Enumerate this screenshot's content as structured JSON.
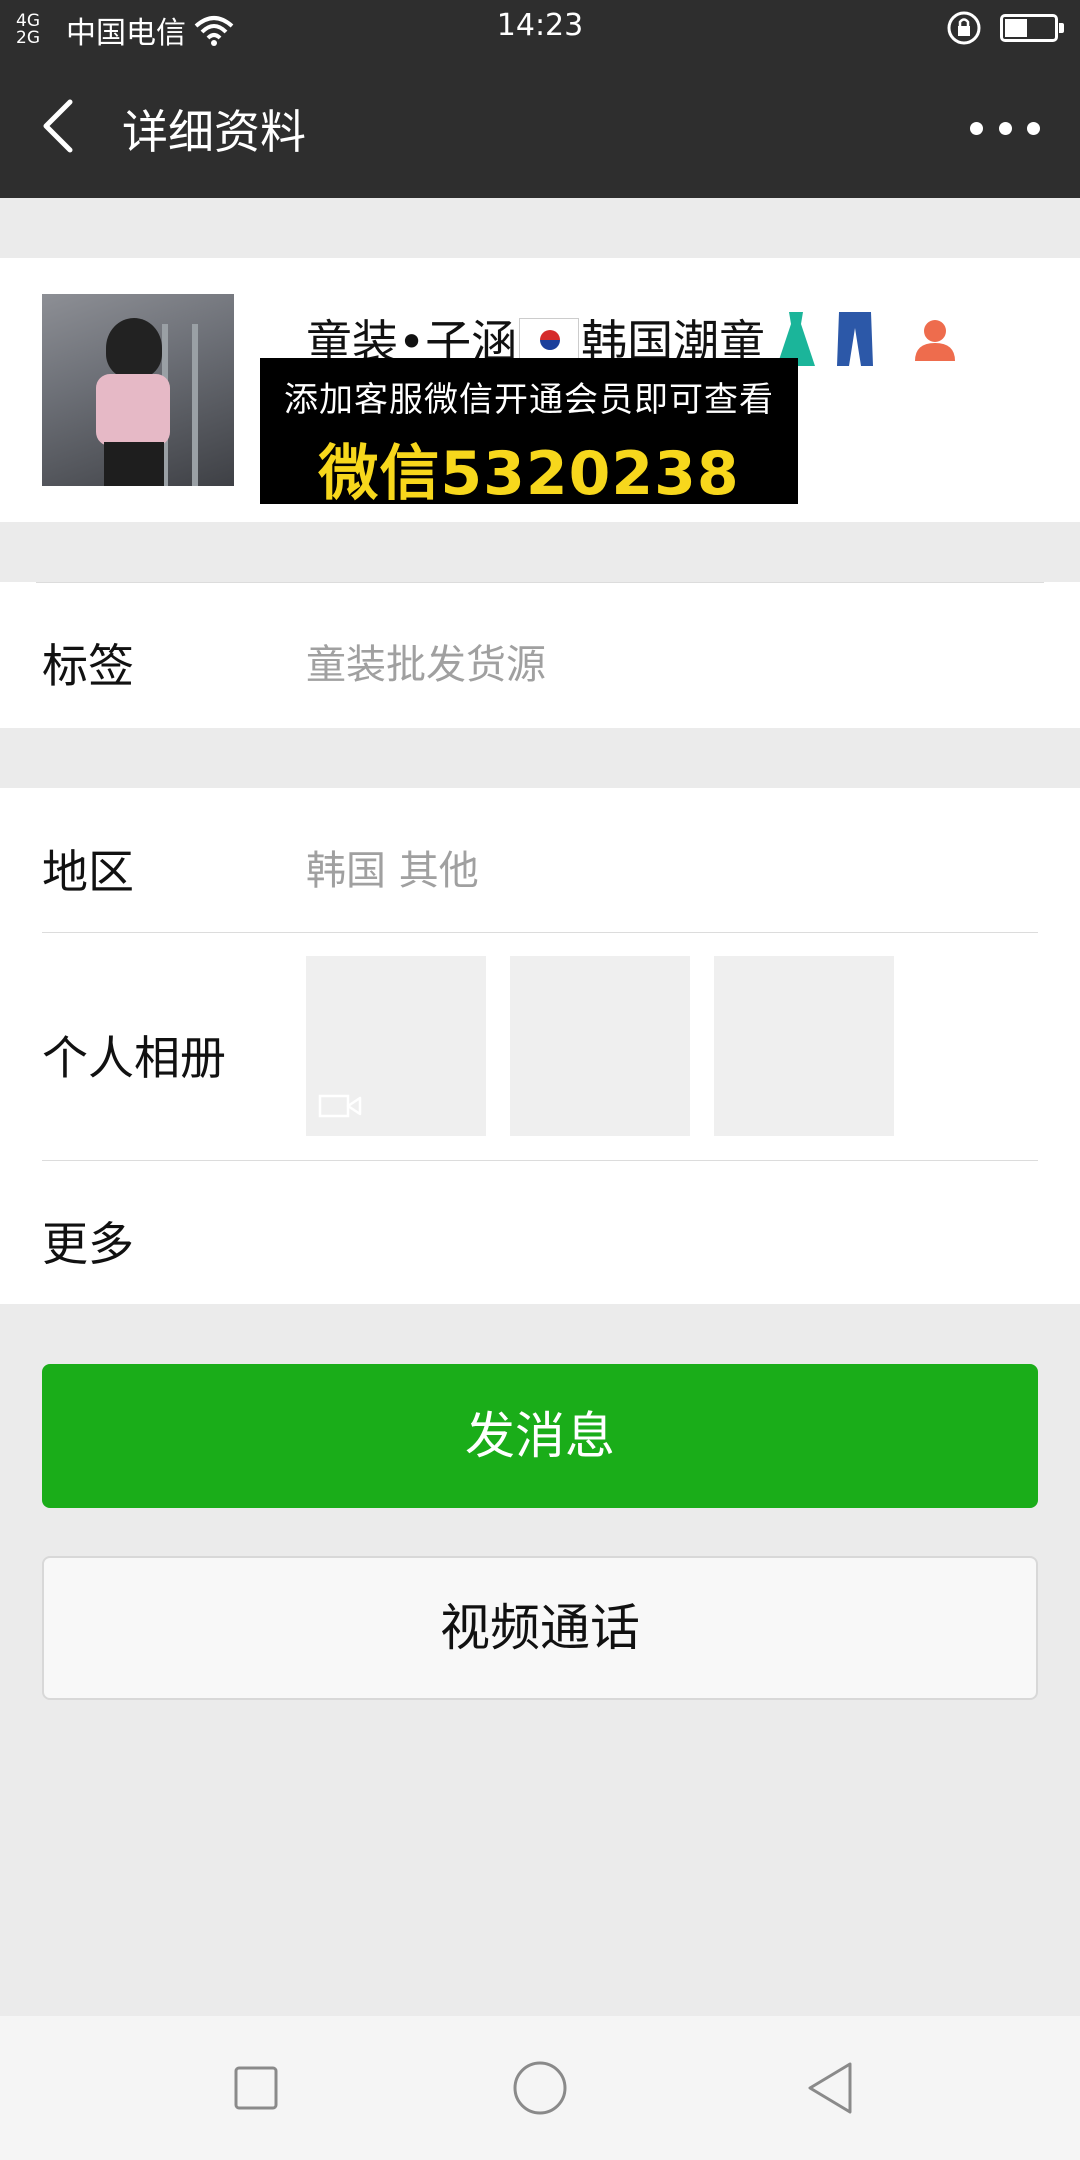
{
  "status_bar": {
    "network": "4G\n2G",
    "carrier": "中国电信",
    "time": "14:23",
    "battery_level": 0.45
  },
  "header": {
    "title": "详细资料"
  },
  "profile": {
    "name": "童装•子涵",
    "name_suffix": "韩国潮童",
    "promo_line1": "添加客服微信开通会员即可查看",
    "promo_line2": "微信5320238"
  },
  "details": {
    "tag_label": "标签",
    "tag_value": "童装批发货源",
    "region_label": "地区",
    "region_value": "韩国  其他",
    "album_label": "个人相册",
    "more_label": "更多"
  },
  "actions": {
    "send_message": "发消息",
    "video_call": "视频通话"
  },
  "colors": {
    "primary_green": "#1aad19",
    "header_bg": "#2e2e2e",
    "promo_yellow": "#f7d71c"
  }
}
